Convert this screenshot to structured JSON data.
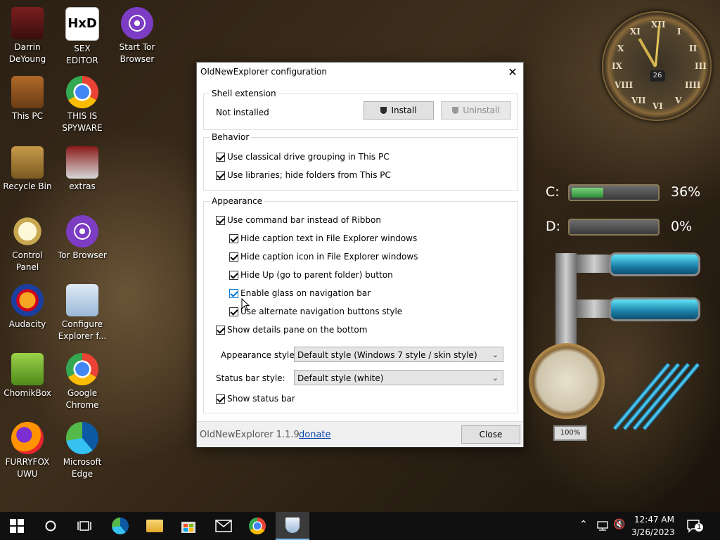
{
  "desktop": {
    "icons": [
      {
        "label": "Darrin\nDeYoung"
      },
      {
        "label": "SEX\nEDITOR"
      },
      {
        "label": "Start Tor\nBrowser"
      },
      {
        "label": "This PC"
      },
      {
        "label": "THIS IS\nSPYWARE"
      },
      {
        "label": "Recycle Bin"
      },
      {
        "label": "extras"
      },
      {
        "label": "Control Panel"
      },
      {
        "label": "Tor Browser"
      },
      {
        "label": "Audacity"
      },
      {
        "label": "Configure\nExplorer f..."
      },
      {
        "label": "ChomikBox"
      },
      {
        "label": "Google\nChrome"
      },
      {
        "label": "FURRYFOX\nUWU"
      },
      {
        "label": "Microsoft\nEdge"
      }
    ]
  },
  "widgets": {
    "clock": {
      "numerals": [
        "XII",
        "I",
        "II",
        "III",
        "IIII",
        "V",
        "VI",
        "VII",
        "VIII",
        "IX",
        "X",
        "XI"
      ],
      "date": "26"
    },
    "drives": [
      {
        "label": "C:",
        "percent_text": "36%",
        "fill_fraction": 0.36
      },
      {
        "label": "D:",
        "percent_text": "0%",
        "fill_fraction": 0.0
      }
    ],
    "gauge_label": "100%"
  },
  "dialog": {
    "title": "OldNewExplorer configuration",
    "shell_extension": {
      "title": "Shell extension",
      "status": "Not installed",
      "install_label": "Install",
      "uninstall_label": "Uninstall"
    },
    "behavior": {
      "title": "Behavior",
      "options": [
        {
          "label": "Use classical drive grouping in This PC",
          "checked": true
        },
        {
          "label": "Use libraries; hide folders from This PC",
          "checked": true
        }
      ]
    },
    "appearance": {
      "title": "Appearance",
      "options": [
        {
          "label": "Use command bar instead of Ribbon",
          "checked": true
        },
        {
          "label": "Hide caption text in File Explorer windows",
          "checked": true
        },
        {
          "label": "Hide caption icon in File Explorer windows",
          "checked": true
        },
        {
          "label": "Hide Up (go to parent folder) button",
          "checked": true
        },
        {
          "label": "Enable glass on navigation bar",
          "checked": true
        },
        {
          "label": "Use alternate navigation buttons style",
          "checked": true
        },
        {
          "label": "Show details pane on the bottom",
          "checked": true
        },
        {
          "label": "Show status bar",
          "checked": true
        }
      ],
      "appearance_style_label": "Appearance style:",
      "appearance_style_value": "Default style (Windows 7 style / skin style)",
      "status_bar_style_label": "Status bar style:",
      "status_bar_style_value": "Default style (white)"
    },
    "footer": {
      "version": "OldNewExplorer 1.1.9",
      "donate": "donate",
      "close_label": "Close"
    }
  },
  "taskbar": {
    "time": "12:47 AM",
    "date": "3/26/2023",
    "notification_count": "1"
  }
}
